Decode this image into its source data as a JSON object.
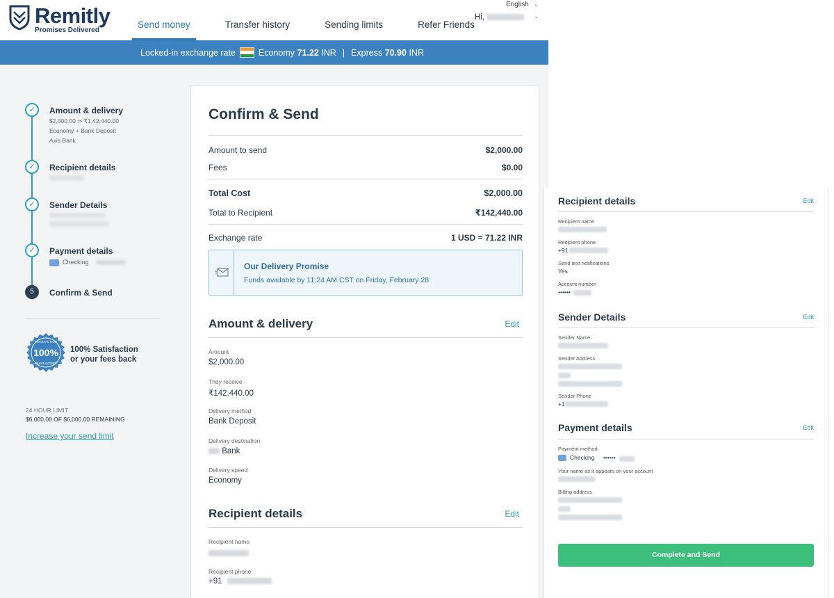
{
  "brand": {
    "name": "Remitly",
    "tagline": "Promises Delivered"
  },
  "nav": {
    "items": [
      "Send money",
      "Transfer history",
      "Sending limits",
      "Refer Friends"
    ],
    "active": "Send money"
  },
  "header": {
    "language": "English",
    "greeting": "Hi,"
  },
  "rate_bar": {
    "label": "Locked-in exchange rate",
    "economy_label": "Economy",
    "economy_value": "71.22",
    "economy_unit": "INR",
    "separator": "|",
    "express_label": "Express",
    "express_value": "70.90",
    "express_unit": "INR"
  },
  "steps": [
    {
      "title": "Amount & delivery",
      "lines": [
        "$2,000.00 ⇒ ₹1,42,440.00",
        "Economy + Bank Deposit",
        "Axis Bank"
      ],
      "done": true
    },
    {
      "title": "Recipient details",
      "done": true
    },
    {
      "title": "Sender Details",
      "done": true
    },
    {
      "title": "Payment details",
      "payment_method": "Checking",
      "done": true
    },
    {
      "title": "Confirm & Send",
      "number": "5",
      "done": false
    }
  ],
  "guarantee": {
    "badge_number": "100%",
    "badge_ring_top": "SATISFACTION",
    "badge_ring_bottom": "GUARANTEED",
    "line1": "100% Satisfaction",
    "line2": "or your fees back"
  },
  "limit": {
    "label": "24 HOUR LIMIT",
    "value": "$6,000.00 OF $6,000.00 REMAINING",
    "link": "Increase your send limit"
  },
  "confirm": {
    "title": "Confirm & Send",
    "amount_label": "Amount to send",
    "amount_value": "$2,000.00",
    "fees_label": "Fees",
    "fees_value": "$0.00",
    "total_cost_label": "Total Cost",
    "total_cost_value": "$2,000.00",
    "total_recipient_label": "Total to Recipient",
    "total_recipient_value": "₹142,440.00",
    "rate_label": "Exchange rate",
    "rate_value": "1 USD = 71.22 INR",
    "promise_title": "Our Delivery Promise",
    "promise_text": "Funds available by 11:24 AM CST on Friday, February 28"
  },
  "amount_delivery": {
    "title": "Amount & delivery",
    "edit": "Edit",
    "amount_label": "Amount",
    "amount_value": "$2,000.00",
    "receive_label": "They receive",
    "receive_value": "₹142,440.00",
    "method_label": "Delivery method",
    "method_value": "Bank Deposit",
    "destination_label": "Delivery destination",
    "destination_value": "Bank",
    "speed_label": "Delivery speed",
    "speed_value": "Economy"
  },
  "recipient_main": {
    "title": "Recipient details",
    "edit": "Edit",
    "name_label": "Recipient name",
    "phone_label": "Recipient phone",
    "phone_prefix": "+91"
  },
  "right_panel": {
    "recipient": {
      "title": "Recipient details",
      "edit": "Edit",
      "name_label": "Recipient name",
      "phone_label": "Recipient phone",
      "phone_prefix": "+91",
      "notify_label": "Send text notifications",
      "notify_value": "Yes",
      "account_label": "Account number",
      "account_value": "••••••"
    },
    "sender": {
      "title": "Sender Details",
      "edit": "Edit",
      "name_label": "Sender Name",
      "address_label": "Sender Address",
      "phone_label": "Sender Phone",
      "phone_prefix": "+1"
    },
    "payment": {
      "title": "Payment details",
      "edit": "Edit",
      "method_label": "Payment method",
      "method_value": "Checking",
      "method_mask": "••••••",
      "account_name_label": "Your name as it appears on your account",
      "billing_label": "Billing address"
    },
    "complete_button": "Complete and Send"
  },
  "colors": {
    "brand_blue": "#3c82c0",
    "link_teal": "#2a9bb5",
    "step_teal": "#2d9ec6",
    "cta_green": "#3dbf7c",
    "dark_text": "#2b3a4a"
  }
}
